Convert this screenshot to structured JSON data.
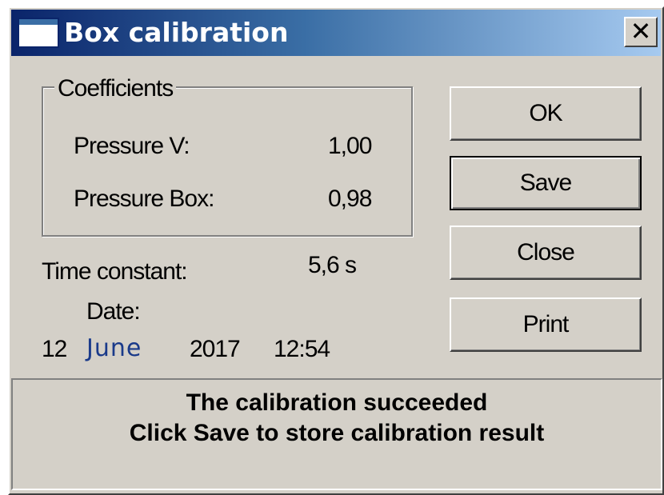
{
  "window": {
    "title": "Box calibration",
    "close_glyph": "✕"
  },
  "coefficients": {
    "legend": "Coefficients",
    "pressure_v_label": "Pressure V:",
    "pressure_v_value": "1,00",
    "pressure_box_label": "Pressure Box:",
    "pressure_box_value": "0,98"
  },
  "time_constant": {
    "label": "Time constant:",
    "value": "5,6 s"
  },
  "date": {
    "label": "Date:",
    "day": "12",
    "month": "June",
    "year": "2017",
    "time": "12:54"
  },
  "buttons": {
    "ok": "OK",
    "save": "Save",
    "close": "Close",
    "print": "Print"
  },
  "status": {
    "line1": "The calibration succeeded",
    "line2": "Click Save to store calibration result"
  },
  "colors": {
    "face": "#d4d0c8",
    "title_start": "#0a246a",
    "title_end": "#a6caf0",
    "month_text": "#1a3a8a"
  }
}
